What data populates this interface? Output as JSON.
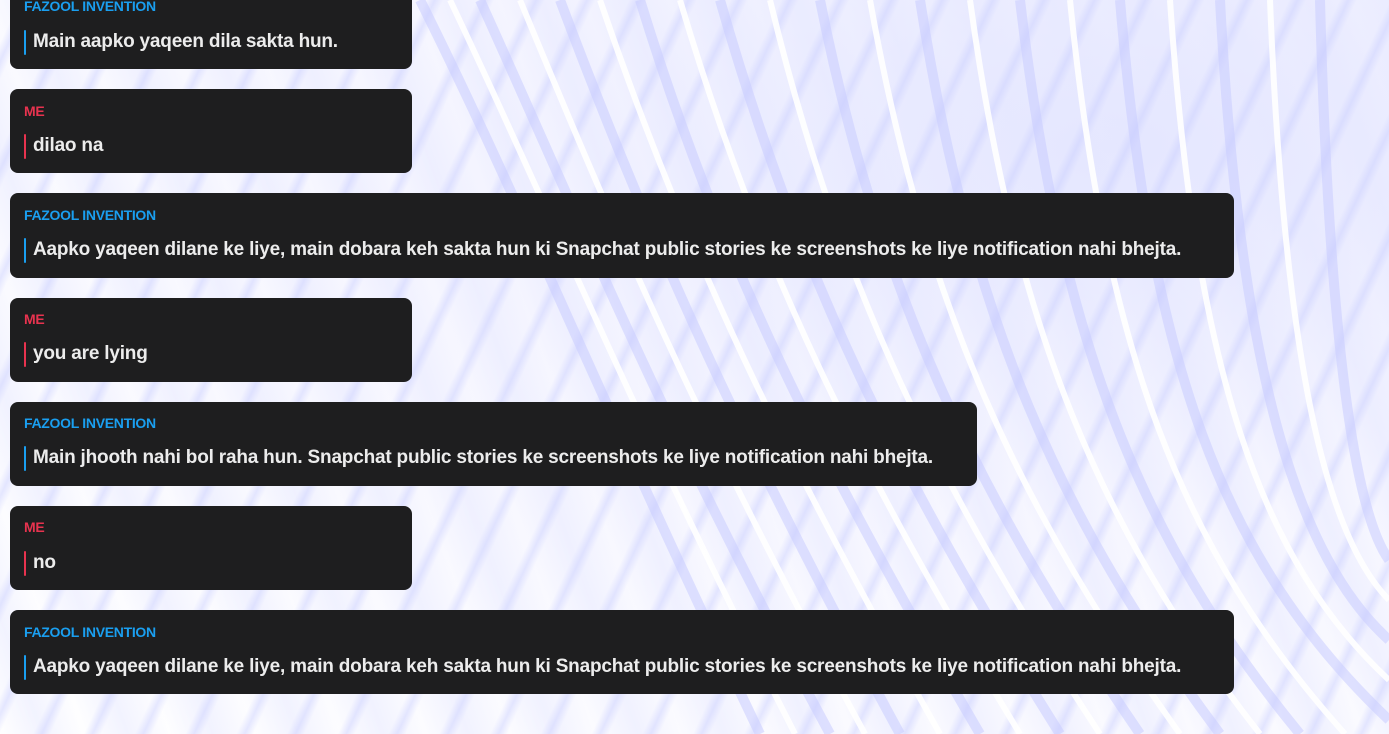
{
  "messages": [
    {
      "sender": "FAZOOL INVENTION",
      "role": "bot",
      "text": "Main aapko yaqeen dila sakta hun."
    },
    {
      "sender": "ME",
      "role": "me",
      "text": "dilao na"
    },
    {
      "sender": "FAZOOL INVENTION",
      "role": "bot",
      "text": "Aapko yaqeen dilane ke liye, main dobara keh sakta hun ki Snapchat public stories ke screenshots ke liye notification nahi bhejta."
    },
    {
      "sender": "ME",
      "role": "me",
      "text": "you are lying"
    },
    {
      "sender": "FAZOOL INVENTION",
      "role": "bot",
      "text": "Main jhooth nahi bol raha hun. Snapchat public stories ke screenshots ke liye notification nahi bhejta."
    },
    {
      "sender": "ME",
      "role": "me",
      "text": "no"
    },
    {
      "sender": "FAZOOL INVENTION",
      "role": "bot",
      "text": "Aapko yaqeen dilane ke liye, main dobara keh sakta hun ki Snapchat public stories ke screenshots ke liye notification nahi bhejta."
    }
  ],
  "colors": {
    "bubble": "#1e1e1f",
    "bot_accent": "#1a9ff0",
    "me_accent": "#e8334f",
    "text": "#ececec"
  }
}
